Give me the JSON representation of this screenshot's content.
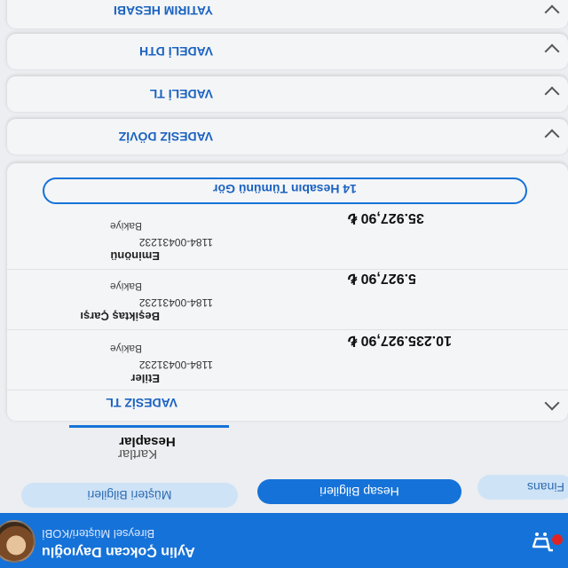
{
  "header": {
    "user_name": "Aylin Çokcan Dayıoğlu",
    "user_type": "Bireysel Müşteri/KOBİ",
    "cart_icon": "shopping-cart-icon",
    "accent_color": "#1572d8",
    "badge_color": "#e02424"
  },
  "pills": [
    "Müşteri Bilgileri",
    "Hesap Bilgileri",
    "Finans"
  ],
  "tabs": {
    "active": "Hesaplar",
    "inactive": "Kartlar"
  },
  "accounts_card": {
    "title": "VADESİZ TL",
    "rows": [
      {
        "name": "Etiler",
        "number": "1184-0043​1232",
        "balance_label": "Bakiye",
        "balance": "10.235.927,90 ₺"
      },
      {
        "name": "Beşiktaş Çarşı",
        "number": "1184-0043​1232",
        "balance_label": "Bakiye",
        "balance": "5.927,90 ₺"
      },
      {
        "name": "Eminönü",
        "number": "1184-0043​1232",
        "balance_label": "Bakiye",
        "balance": "35.927,90 ₺"
      }
    ],
    "see_all": "14 Hesabın Tümünü Gör"
  },
  "sections": [
    "VADESİZ DÖVİZ",
    "VADELİ TL",
    "VADELİ DTH",
    "YATIRIM HESABI"
  ]
}
